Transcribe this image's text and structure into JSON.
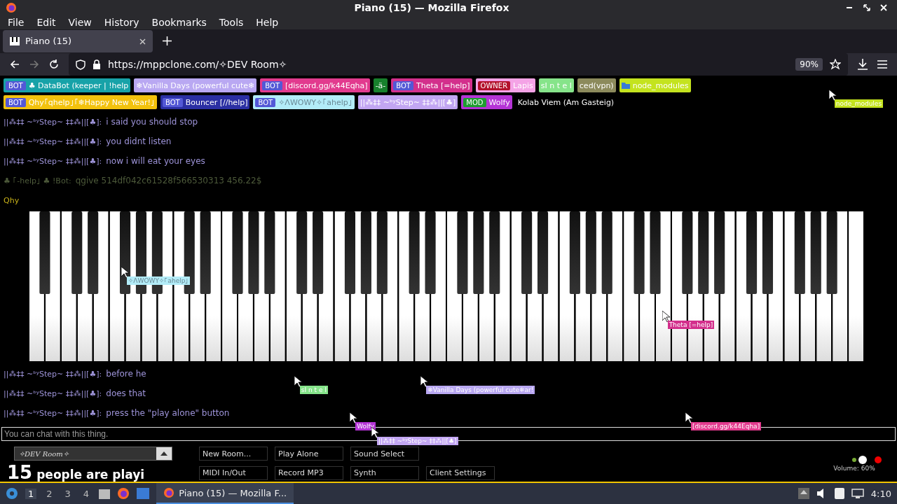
{
  "window": {
    "title": "Piano (15) — Mozilla Firefox"
  },
  "menu": [
    "File",
    "Edit",
    "View",
    "History",
    "Bookmarks",
    "Tools",
    "Help"
  ],
  "tabs": [
    {
      "label": "Piano (15)",
      "selected": true
    }
  ],
  "address": {
    "url": "https://mppclone.com/✧DEV Room✧",
    "zoom": "90%"
  },
  "users": [
    [
      {
        "tag": "BOT",
        "kind": "bot",
        "name": "♣ DataBot (keeper | !help",
        "color": "#17a2a8"
      },
      {
        "name": "❄Vanilla Days (powerful cute❄",
        "color": "#b9a8f2"
      },
      {
        "tag": "BOT",
        "kind": "bot",
        "name": "[discord.gg/k44Eqha]",
        "color": "#e23a8e"
      },
      {
        "name": "-ä-",
        "color": "#17802c"
      },
      {
        "tag": "BOT",
        "kind": "bot",
        "name": "Theta [=help]",
        "color": "#d32f8c"
      },
      {
        "tag": "OWNER",
        "kind": "owner",
        "name": "Lapis",
        "color": "#f4a3e6"
      },
      {
        "name": "ꜱI n t e l",
        "color": "#86e48a"
      },
      {
        "name": "ced(vpn)",
        "color": "#8c8a5c"
      },
      {
        "name": "node_modules",
        "kind": "folder",
        "color": "#c4e31e"
      }
    ],
    [
      {
        "tag": "BOT",
        "kind": "bot",
        "name": "Qhy｢qhelp｣｢❄Happy New Year!｣",
        "color": "#f3c20d"
      },
      {
        "tag": "BOT",
        "kind": "bot",
        "name": "Bouncer [//help]",
        "color": "#2b2fa3"
      },
      {
        "tag": "BOT",
        "kind": "bot",
        "name": "✧ΛWOWY✧｢ahelp｣",
        "color": "#b3ecf8"
      },
      {
        "name": "||⁂‡‡ ~ᵇʸStep~ ‡‡⁂||[♣]",
        "color": "#c2a6f2"
      },
      {
        "tag": "MOD",
        "kind": "mod",
        "name": "Wolfy",
        "color": "#b534d6"
      },
      {
        "name": "Kolab Viem (Am Gasteig)",
        "color": "#000000"
      }
    ]
  ],
  "chat_top": [
    {
      "name": "||⁂‡‡ ~ᵇʸStep~ ‡‡⁂||[♣]:",
      "text": "i said you should stop",
      "color": "#9d93d8"
    },
    {
      "name": "||⁂‡‡ ~ᵇʸStep~ ‡‡⁂||[♣]:",
      "text": "you didnt listen",
      "color": "#9d93d8"
    },
    {
      "name": "||⁂‡‡ ~ᵇʸStep~ ‡‡⁂||[♣]:",
      "text": "now i will eat your eyes",
      "color": "#9d93d8"
    },
    {
      "name": "♣ ｢-help｣ ♣ !Bot:",
      "text": "qgive 514df042c61528f566530313 456.22$",
      "color": "#4d5a3a"
    },
    {
      "name": "Qhy",
      "color": "#c9b21a"
    }
  ],
  "chat_bottom": [
    {
      "name": "||⁂‡‡ ~ᵇʸStep~ ‡‡⁂||[♣]:",
      "text": "before he",
      "color": "#9d93d8"
    },
    {
      "name": "||⁂‡‡ ~ᵇʸStep~ ‡‡⁂||[♣]:",
      "text": "does that",
      "color": "#9d93d8"
    },
    {
      "name": "||⁂‡‡ ~ᵇʸStep~ ‡‡⁂||[♣]:",
      "text": "press the \"play alone\" button",
      "color": "#9d93d8"
    }
  ],
  "cursors": [
    {
      "label": "✧ΛWOWY✧｢ahelp｣",
      "color": "#b3ecf8"
    },
    {
      "label": "Theta [=help]",
      "color": "#d32f8c"
    },
    {
      "label": "ꜱI n t e l",
      "color": "#86e48a"
    },
    {
      "label": "❄Vanilla Days (powerful cute❄ar!",
      "color": "#b9a8f2"
    },
    {
      "label": "Wolfy",
      "color": "#b534d6"
    },
    {
      "label": "||⁂‡‡ ~ᵇʸStep~ ‡‡⁂||[♣]",
      "color": "#c2a6f2"
    },
    {
      "label": "[discord.gg/k44Eqha]",
      "color": "#e23a8e"
    },
    {
      "label": "node_modules",
      "color": "#c4e31e"
    }
  ],
  "chat_input": {
    "placeholder": "You can chat with this thing."
  },
  "room": {
    "value": "✧DEV Room✧"
  },
  "people": {
    "count": "15",
    "text": "people are playi"
  },
  "buttons": [
    "New Room...",
    "Play Alone",
    "Sound Select",
    "MIDI In/Out",
    "Record MP3",
    "Synth",
    "Client Settings"
  ],
  "volume": {
    "label": "Volume: 60%"
  },
  "taskbar": {
    "workspaces": [
      {
        "label": "1",
        "selected": true
      },
      {
        "label": "2",
        "selected": false
      },
      {
        "label": "3",
        "selected": false
      },
      {
        "label": "4",
        "selected": false
      }
    ],
    "task": "Piano (15) — Mozilla F...",
    "clock": "4:10"
  }
}
